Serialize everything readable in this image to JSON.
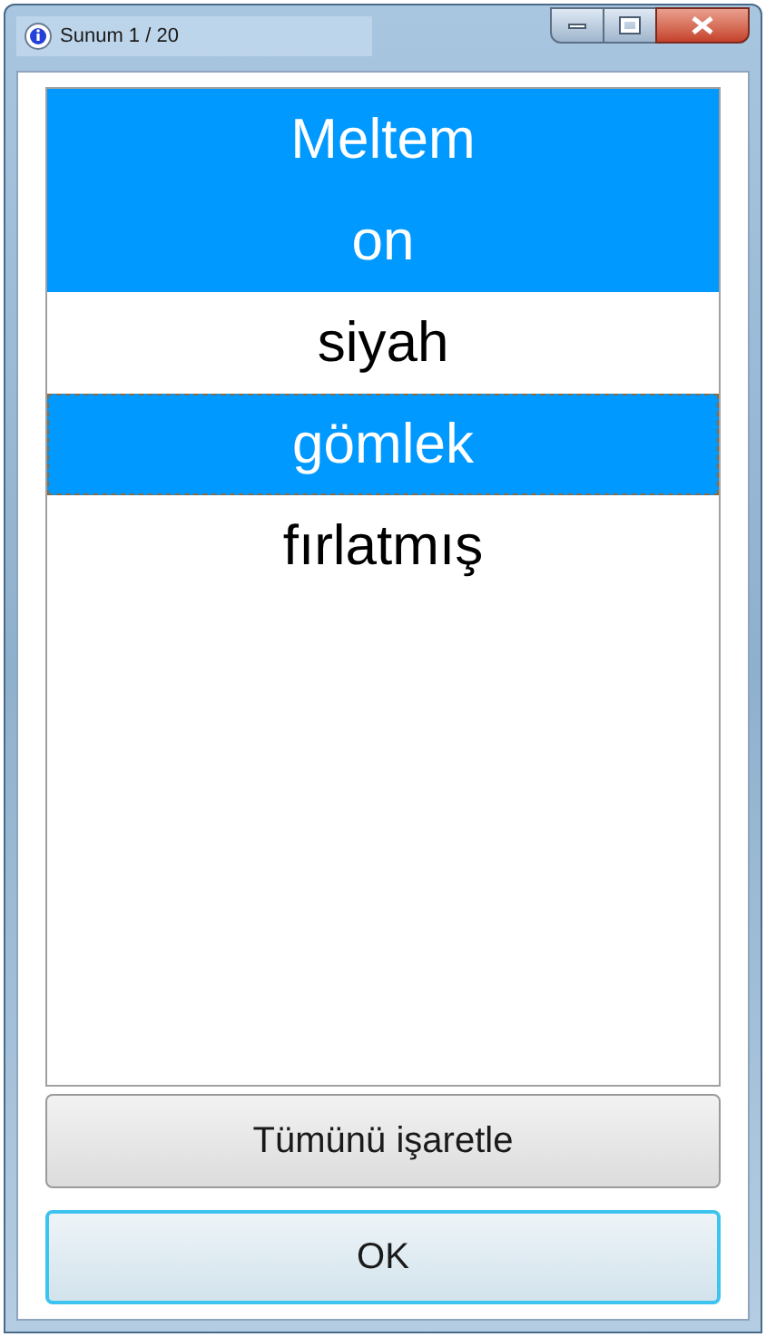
{
  "window": {
    "title": "Sunum 1 / 20"
  },
  "items": [
    {
      "label": "Meltem",
      "selected": true,
      "focused": false
    },
    {
      "label": "on",
      "selected": true,
      "focused": false
    },
    {
      "label": "siyah",
      "selected": false,
      "focused": false
    },
    {
      "label": "gömlek",
      "selected": true,
      "focused": true
    },
    {
      "label": "fırlatmış",
      "selected": false,
      "focused": false
    }
  ],
  "buttons": [
    {
      "label": "Tümünü işaretle",
      "default": false
    },
    {
      "label": "OK",
      "default": true
    }
  ]
}
